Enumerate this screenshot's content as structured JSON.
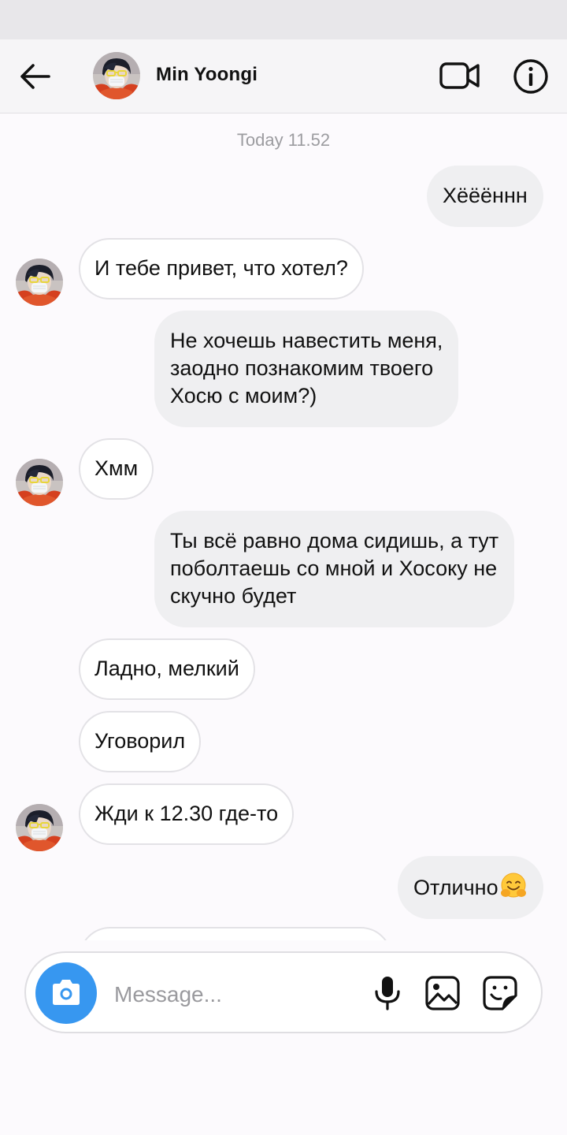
{
  "header": {
    "contact_name": "Min Yoongi"
  },
  "chat": {
    "timestamp": "Today 11.52",
    "messages": [
      {
        "direction": "outgoing",
        "text": "Хёёённн"
      },
      {
        "direction": "incoming",
        "text": "И тебе привет, что хотел?"
      },
      {
        "direction": "outgoing",
        "text": "Не хочешь навестить меня,\nзаодно познакомим твоего\nХосю с моим?)"
      },
      {
        "direction": "incoming",
        "text": "Хмм"
      },
      {
        "direction": "outgoing",
        "text": "Ты всё равно дома сидишь, а тут\nпоболтаешь со мной и Хосоку не\nскучно будет"
      },
      {
        "direction": "incoming",
        "text": "Ладно, мелкий"
      },
      {
        "direction": "incoming",
        "text": "Уговорил"
      },
      {
        "direction": "incoming",
        "text": "Жди к 12.30 где-то"
      },
      {
        "direction": "outgoing",
        "text": "Отлично",
        "emoji": "hugging-face"
      }
    ]
  },
  "composer": {
    "placeholder": "Message..."
  },
  "colors": {
    "accent": "#3797f0",
    "outgoing_bubble": "#efeff1",
    "incoming_bubble": "#ffffff"
  },
  "icons": [
    "back-arrow-icon",
    "video-call-icon",
    "info-icon",
    "camera-icon",
    "microphone-icon",
    "gallery-icon",
    "sticker-icon",
    "hugging-face-emoji"
  ]
}
